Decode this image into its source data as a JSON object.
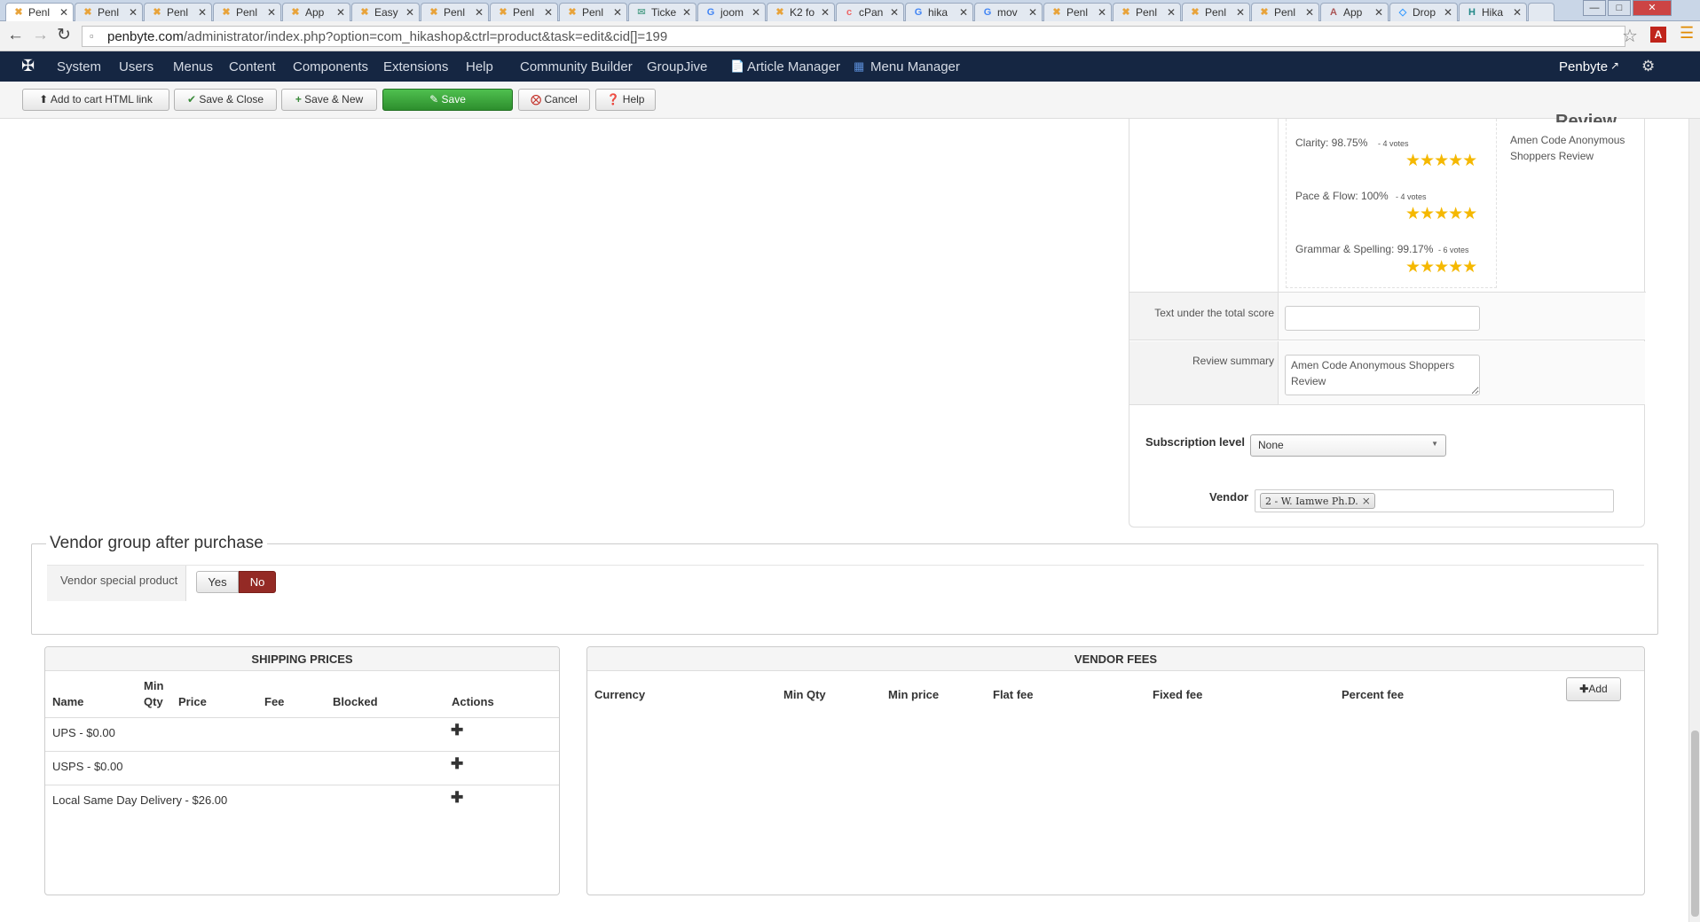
{
  "browser": {
    "tabs": [
      {
        "label": "Penl",
        "icon": "joomla"
      },
      {
        "label": "Penl",
        "icon": "joomla"
      },
      {
        "label": "Penl",
        "icon": "joomla"
      },
      {
        "label": "Penl",
        "icon": "joomla"
      },
      {
        "label": "App",
        "icon": "joomla"
      },
      {
        "label": "Easy",
        "icon": "joomla"
      },
      {
        "label": "Penl",
        "icon": "joomla"
      },
      {
        "label": "Penl",
        "icon": "joomla"
      },
      {
        "label": "Penl",
        "icon": "joomla"
      },
      {
        "label": "Ticke",
        "icon": "ticket"
      },
      {
        "label": "joom",
        "icon": "google"
      },
      {
        "label": "K2 fo",
        "icon": "joomla"
      },
      {
        "label": "cPan",
        "icon": "cpanel"
      },
      {
        "label": "hika",
        "icon": "google"
      },
      {
        "label": "mov",
        "icon": "google"
      },
      {
        "label": "Penl",
        "icon": "joomla"
      },
      {
        "label": "Penl",
        "icon": "joomla"
      },
      {
        "label": "Penl",
        "icon": "joomla"
      },
      {
        "label": "Penl",
        "icon": "joomla"
      },
      {
        "label": "App",
        "icon": "app"
      },
      {
        "label": "Drop",
        "icon": "drop"
      },
      {
        "label": "Hika",
        "icon": "hika"
      }
    ],
    "url_host": "penbyte.com",
    "url_path": "/administrator/index.php?option=com_hikashop&ctrl=product&task=edit&cid[]=199"
  },
  "admin_nav": {
    "items": [
      "System",
      "Users",
      "Menus",
      "Content",
      "Components",
      "Extensions",
      "Help",
      "Community Builder",
      "GroupJive",
      "Article Manager",
      "Menu Manager"
    ],
    "site_name": "Penbyte"
  },
  "toolbar": {
    "add_to_cart": "Add to cart HTML link",
    "save_close": "Save & Close",
    "save_new": "Save & New",
    "save": "Save",
    "cancel": "Cancel",
    "help": "Help"
  },
  "review": {
    "heading_partial": "Review",
    "criteria": [
      {
        "label": "Clarity: 98.75%",
        "votes": "- 4 votes",
        "stars": 5
      },
      {
        "label": "Pace & Flow: 100%",
        "votes": "- 4 votes",
        "stars": 5
      },
      {
        "label": "Grammar & Spelling: 99.17%",
        "votes": "- 6 votes",
        "stars": 5
      }
    ],
    "side_text": "Amen Code Anonymous Shoppers Review",
    "total_score_label": "Text under the total score",
    "total_score_value": "",
    "summary_label": "Review summary",
    "summary_value": "Amen Code Anonymous Shoppers Review"
  },
  "subscription": {
    "label": "Subscription level",
    "value": "None"
  },
  "vendor": {
    "label": "Vendor",
    "tag": "2 - W. Iamwe Ph.D."
  },
  "vendor_group": {
    "title": "Vendor group after purchase",
    "special_label": "Vendor special product",
    "yes": "Yes",
    "no": "No",
    "selected": "No"
  },
  "shipping": {
    "title": "SHIPPING PRICES",
    "columns": [
      "Name",
      "Min Qty",
      "Price",
      "Fee",
      "Blocked",
      "Actions"
    ],
    "rows": [
      {
        "name": "UPS - $0.00"
      },
      {
        "name": "USPS - $0.00"
      },
      {
        "name": "Local Same Day Delivery - $26.00"
      }
    ]
  },
  "vendor_fees": {
    "title": "VENDOR FEES",
    "columns": [
      "Currency",
      "Min Qty",
      "Min price",
      "Flat fee",
      "Fixed fee",
      "Percent fee"
    ],
    "add_label": "Add"
  },
  "colors": {
    "nav_bg": "#152642",
    "save_green": "#2d8f2d",
    "toggle_no": "#942a25",
    "star": "#f5b800"
  }
}
